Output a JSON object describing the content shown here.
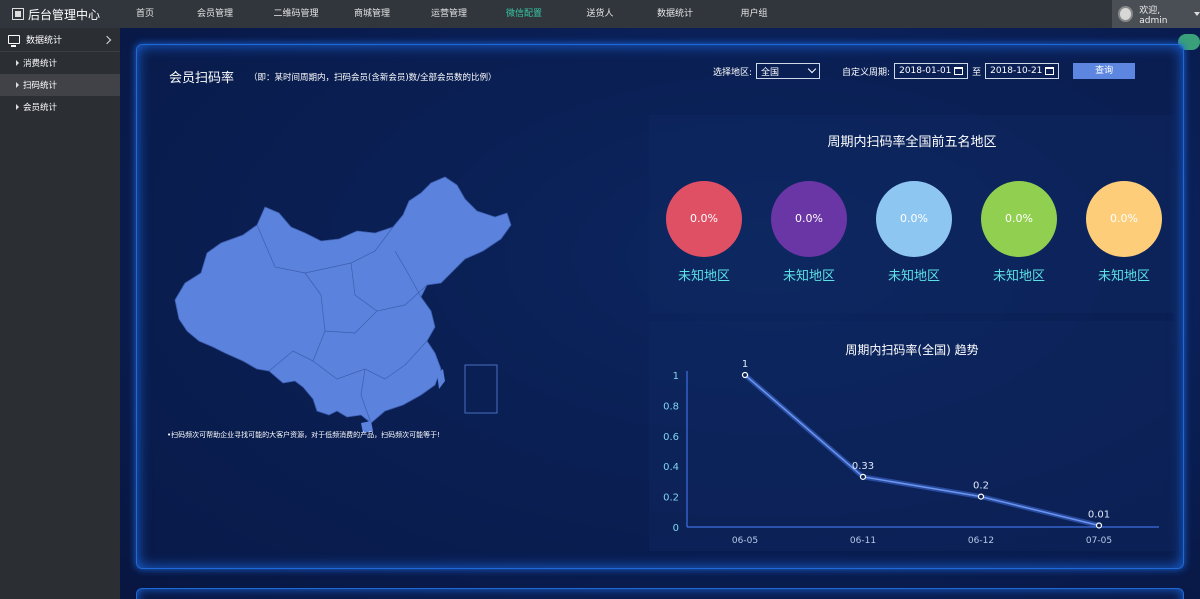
{
  "brand": {
    "title": "后台管理中心"
  },
  "nav": {
    "items": [
      "首页",
      "会员管理",
      "二维码管理",
      "商城管理",
      "运营管理",
      "微信配置",
      "送货人",
      "数据统计",
      "用户组"
    ],
    "active_index": 5
  },
  "user": {
    "greeting": "欢迎, admin"
  },
  "sidebar": {
    "header": "数据统计",
    "items": [
      "消费统计",
      "扫码统计",
      "会员统计"
    ],
    "active_index": 1
  },
  "page": {
    "title": "会员扫码率",
    "subtitle": "（即：某时间周期内，扫码会员(含新会员)数/全部会员数的比例）",
    "filters": {
      "region_label": "选择地区:",
      "region_value": "全国",
      "period_label": "自定义周期:",
      "start_date": "2018-01-01",
      "to_label": "至",
      "end_date": "2018-10-21",
      "query_button": "查询"
    },
    "map_note": "•扫码频次可帮助企业寻找可能的大客户资源，对于低频消费的产品，扫码频次可能等于!"
  },
  "top5": {
    "title": "周期内扫码率全国前五名地区",
    "items": [
      {
        "value": "0.0%",
        "label": "未知地区",
        "color": "#e05064"
      },
      {
        "value": "0.0%",
        "label": "未知地区",
        "color": "#6a35a5"
      },
      {
        "value": "0.0%",
        "label": "未知地区",
        "color": "#8ec6f2"
      },
      {
        "value": "0.0%",
        "label": "未知地区",
        "color": "#90cf50"
      },
      {
        "value": "0.0%",
        "label": "未知地区",
        "color": "#fdcd79"
      }
    ]
  },
  "trend": {
    "title": "周期内扫码率(全国) 趋势"
  },
  "chart_data": {
    "type": "line",
    "categories": [
      "06-05",
      "06-11",
      "06-12",
      "07-05"
    ],
    "values": [
      1,
      0.33,
      0.2,
      0.01
    ],
    "data_labels": [
      "1",
      "0.33",
      "0.2",
      "0.01"
    ],
    "y_ticks": [
      "0",
      "0.2",
      "0.4",
      "0.6",
      "0.8",
      "1"
    ],
    "ylim": [
      0,
      1
    ],
    "grid": false
  }
}
